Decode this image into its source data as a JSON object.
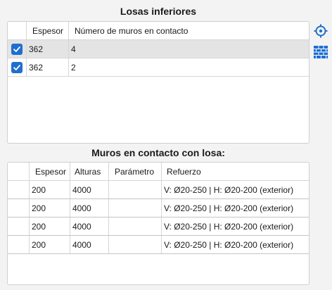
{
  "section_top": {
    "title": "Losas inferiores",
    "columns": [
      "",
      "Espesor",
      "Número de muros en contacto"
    ],
    "rows": [
      {
        "checked": true,
        "espesor": "362",
        "muros": "4"
      },
      {
        "checked": true,
        "espesor": "362",
        "muros": "2"
      }
    ]
  },
  "section_bottom": {
    "title": "Muros en contacto con losa:",
    "columns": [
      "",
      "Espesor",
      "Alturas",
      "Parámetro",
      "Refuerzo"
    ],
    "rows": [
      {
        "espesor": "200",
        "alturas": "4000",
        "parametro": "",
        "refuerzo": "V: Ø20-250 | H: Ø20-200 (exterior)"
      },
      {
        "espesor": "200",
        "alturas": "4000",
        "parametro": "",
        "refuerzo": "V: Ø20-250 | H: Ø20-200 (exterior)"
      },
      {
        "espesor": "200",
        "alturas": "4000",
        "parametro": "",
        "refuerzo": "V: Ø20-250 | H: Ø20-200 (exterior)"
      },
      {
        "espesor": "200",
        "alturas": "4000",
        "parametro": "",
        "refuerzo": "V: Ø20-250 | H: Ø20-200 (exterior)"
      }
    ]
  },
  "toolbar": {
    "icons": [
      "crosshair-icon",
      "brick-wall-icon"
    ]
  },
  "colors": {
    "accent": "#1e6fd0",
    "background": "#f3f3f3",
    "selected_row": "#e4e4e4"
  }
}
